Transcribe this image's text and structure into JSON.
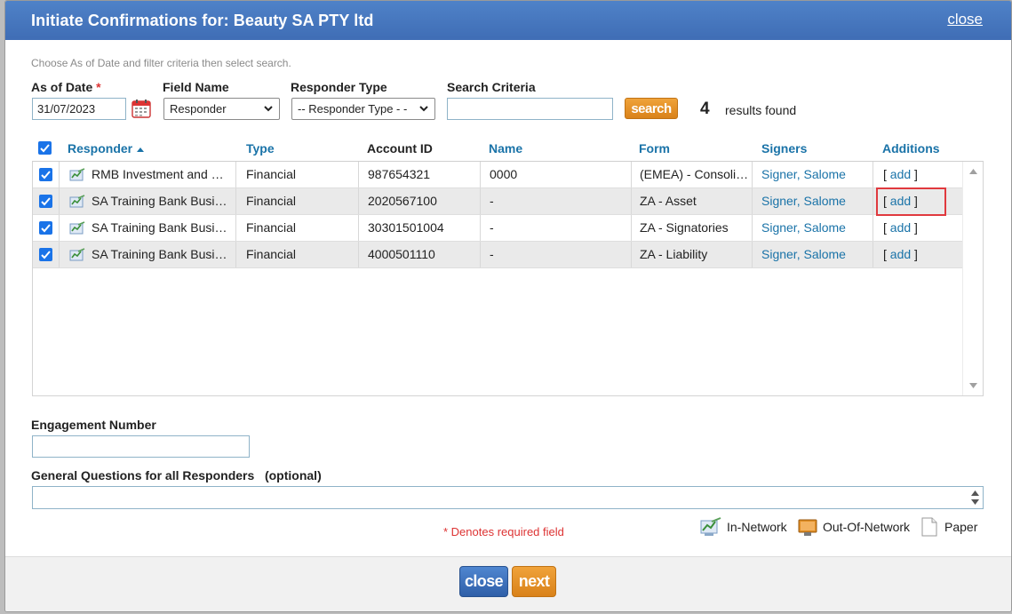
{
  "dialog": {
    "title": "Initiate Confirmations for: Beauty SA PTY ltd",
    "close_link": "close",
    "instructions": "Choose As of Date and filter criteria then select search."
  },
  "filters": {
    "as_of_date_label": "As of Date",
    "required_mark": "*",
    "as_of_date_value": "31/07/2023",
    "field_name_label": "Field Name",
    "field_name_value": "Responder",
    "responder_type_label": "Responder Type",
    "responder_type_value": "-- Responder Type - -",
    "search_criteria_label": "Search Criteria",
    "search_criteria_value": "",
    "search_button": "search",
    "results_count": "4",
    "results_label": "results found"
  },
  "grid": {
    "columns": {
      "responder": "Responder",
      "type": "Type",
      "account_id": "Account ID",
      "name": "Name",
      "form": "Form",
      "signers": "Signers",
      "additions": "Additions"
    },
    "rows": [
      {
        "responder": "RMB Investment and Corporate Banking",
        "type": "Financial",
        "account_id": "987654321",
        "name": "0000",
        "form": "(EMEA) - Consolidated",
        "signers": "Signer, Salome",
        "additions": "add"
      },
      {
        "responder": "SA Training Bank Business",
        "type": "Financial",
        "account_id": "2020567100",
        "name": "-",
        "form": "ZA - Asset",
        "signers": "Signer, Salome",
        "additions": "add"
      },
      {
        "responder": "SA Training Bank Business",
        "type": "Financial",
        "account_id": "30301501004",
        "name": "-",
        "form": "ZA - Signatories",
        "signers": "Signer, Salome",
        "additions": "add"
      },
      {
        "responder": "SA Training Bank Business",
        "type": "Financial",
        "account_id": "4000501110",
        "name": "-",
        "form": "ZA - Liability",
        "signers": "Signer, Salome",
        "additions": "add"
      }
    ]
  },
  "engagement": {
    "label": "Engagement Number",
    "value": ""
  },
  "questions": {
    "label": "General Questions for all Responders",
    "optional": "(optional)"
  },
  "required_note": "* Denotes required field",
  "legend": {
    "in_network": "In-Network",
    "out_of_network": "Out-Of-Network",
    "paper": "Paper"
  },
  "footer": {
    "close_button": "close",
    "next_button": "next"
  },
  "colors": {
    "title_bar": "#4472b9",
    "accent_orange": "#e08e25",
    "link_blue": "#1a73a8",
    "checkbox_blue": "#1a73e8",
    "highlight_red": "#e0393e"
  }
}
